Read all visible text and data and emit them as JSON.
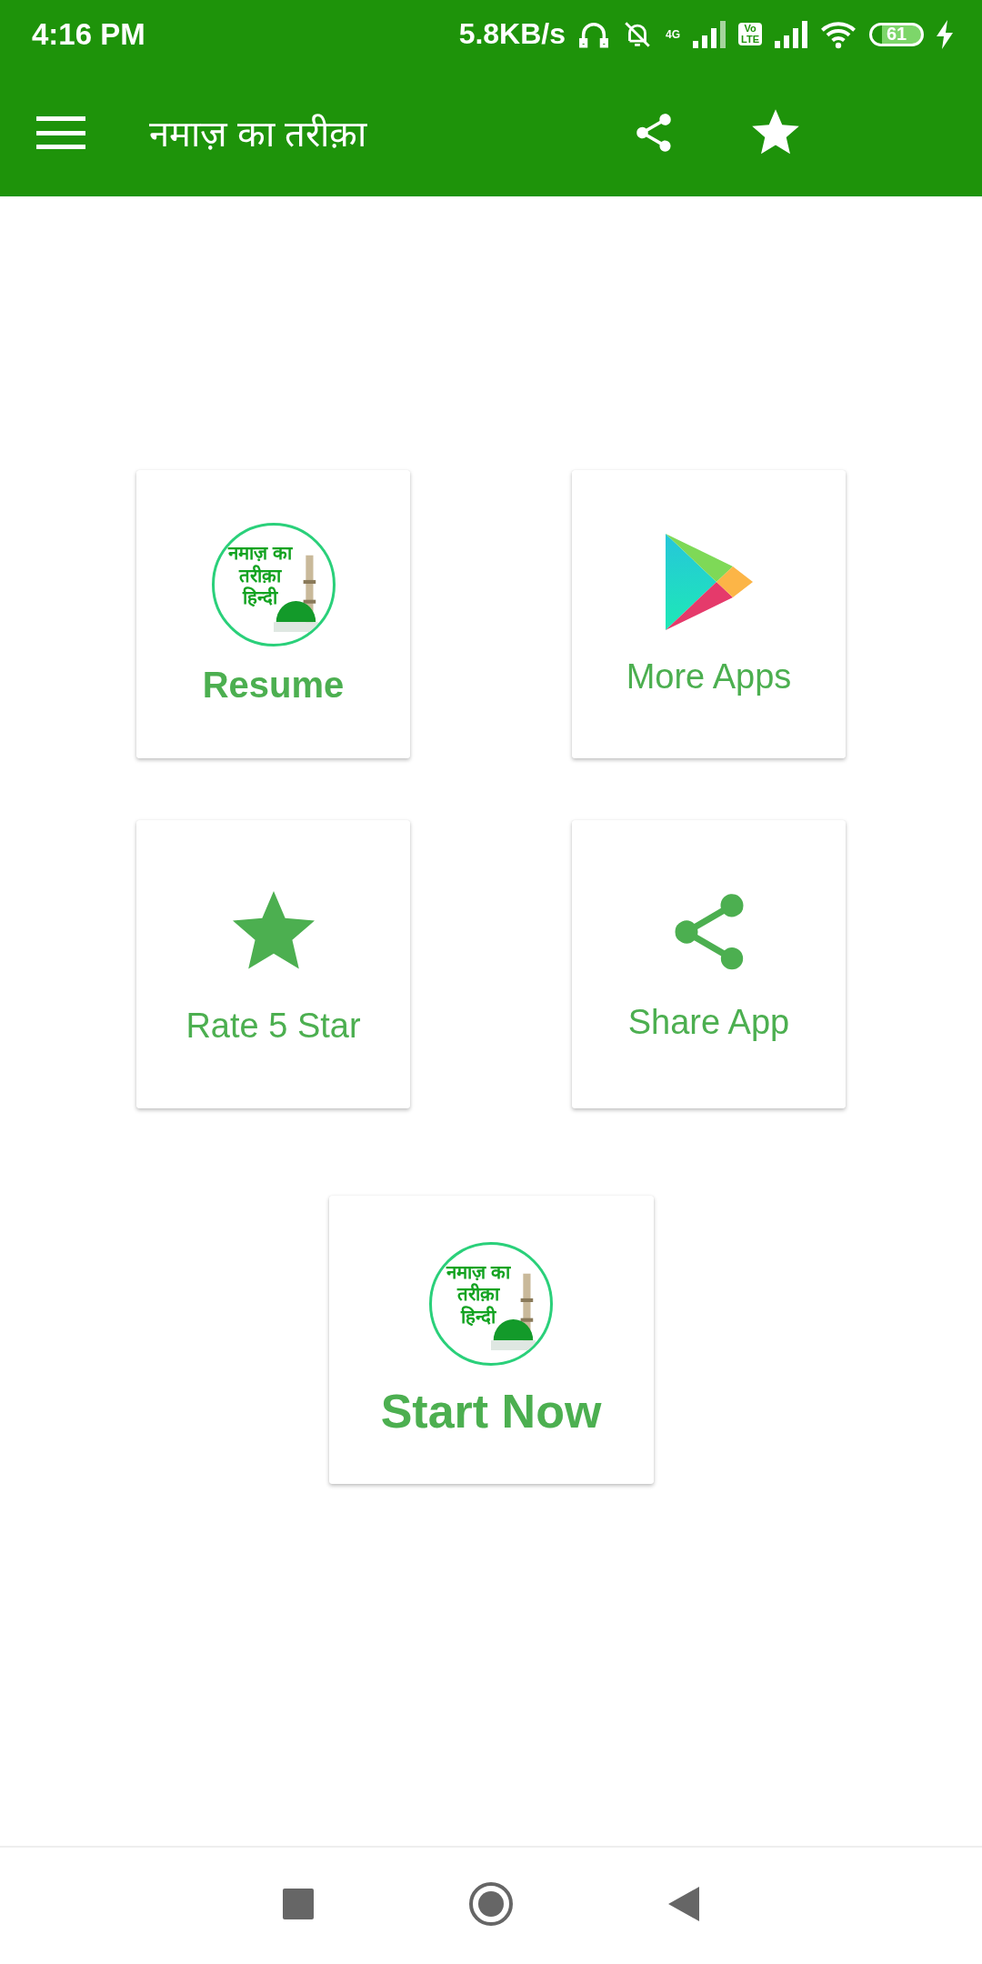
{
  "status_bar": {
    "time": "4:16 PM",
    "net_speed": "5.8KB/s",
    "network_type": "4G",
    "volte": [
      "Vo",
      "LTE"
    ],
    "battery": "61"
  },
  "toolbar": {
    "title": "नमाज़ का तरीक़ा"
  },
  "tiles": [
    {
      "kind": "logo",
      "label": "Resume",
      "logo_lines": [
        "नमाज़ का",
        "तरीक़ा",
        "हिन्दी"
      ]
    },
    {
      "kind": "play",
      "label": "More Apps"
    },
    {
      "kind": "star",
      "label": "Rate 5 Star"
    },
    {
      "kind": "share",
      "label": "Share App"
    }
  ],
  "main_tile": {
    "kind": "logo",
    "label": "Start Now",
    "logo_lines": [
      "नमाज़ का",
      "तरीक़ा",
      "हिन्दी"
    ]
  }
}
